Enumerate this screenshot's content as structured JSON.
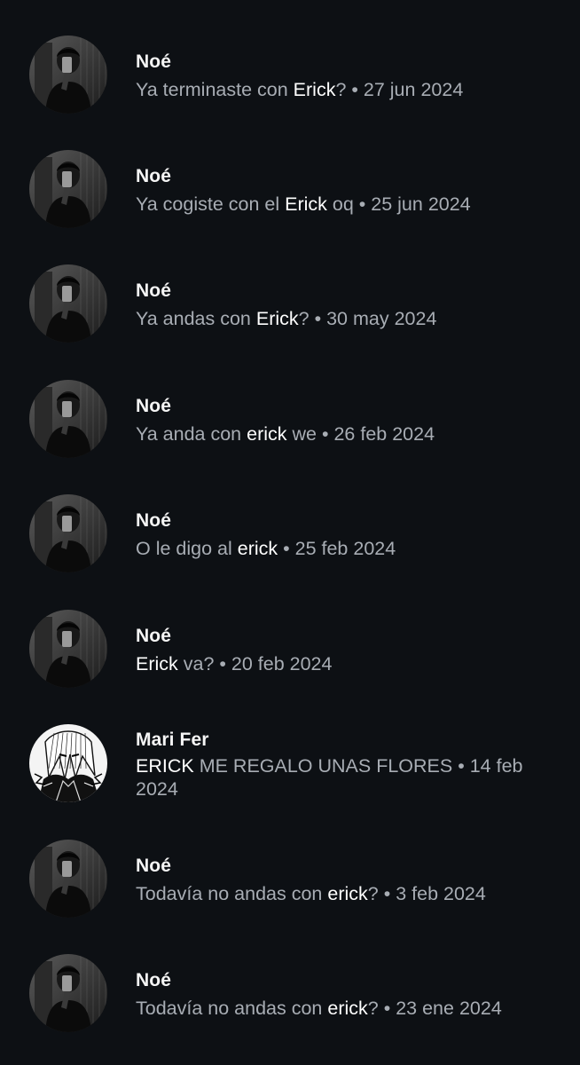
{
  "results": [
    {
      "username": "Noé",
      "avatar": "noe-photo",
      "before": "Ya terminaste con ",
      "keyword": "Erick",
      "after": "?",
      "date": " • 27 jun 2024"
    },
    {
      "username": "Noé",
      "avatar": "noe-photo",
      "before": "Ya cogiste con el ",
      "keyword": "Erick",
      "after": " oq",
      "date": " • 25 jun 2024"
    },
    {
      "username": "Noé",
      "avatar": "noe-photo",
      "before": "Ya andas con ",
      "keyword": "Erick",
      "after": "?",
      "date": " • 30 may 2024"
    },
    {
      "username": "Noé",
      "avatar": "noe-photo",
      "before": "Ya anda con ",
      "keyword": "erick",
      "after": " we",
      "date": " • 26 feb 2024"
    },
    {
      "username": "Noé",
      "avatar": "noe-photo",
      "before": "O le digo al ",
      "keyword": "erick",
      "after": "",
      "date": " • 25 feb 2024"
    },
    {
      "username": "Noé",
      "avatar": "noe-photo",
      "before": "",
      "keyword": "Erick",
      "after": " va?",
      "date": " • 20 feb 2024"
    },
    {
      "username": "Mari Fer",
      "avatar": "manga-character",
      "before": "",
      "keyword": "ERICK",
      "after": " ME REGALO UNAS FLORES",
      "date": " • 14 feb 2024"
    },
    {
      "username": "Noé",
      "avatar": "noe-photo",
      "before": "Todavía no andas con ",
      "keyword": "erick",
      "after": "?",
      "date": " • 3 feb 2024"
    },
    {
      "username": "Noé",
      "avatar": "noe-photo",
      "before": "Todavía no andas con ",
      "keyword": "erick",
      "after": "?",
      "date": " • 23 ene 2024"
    }
  ]
}
